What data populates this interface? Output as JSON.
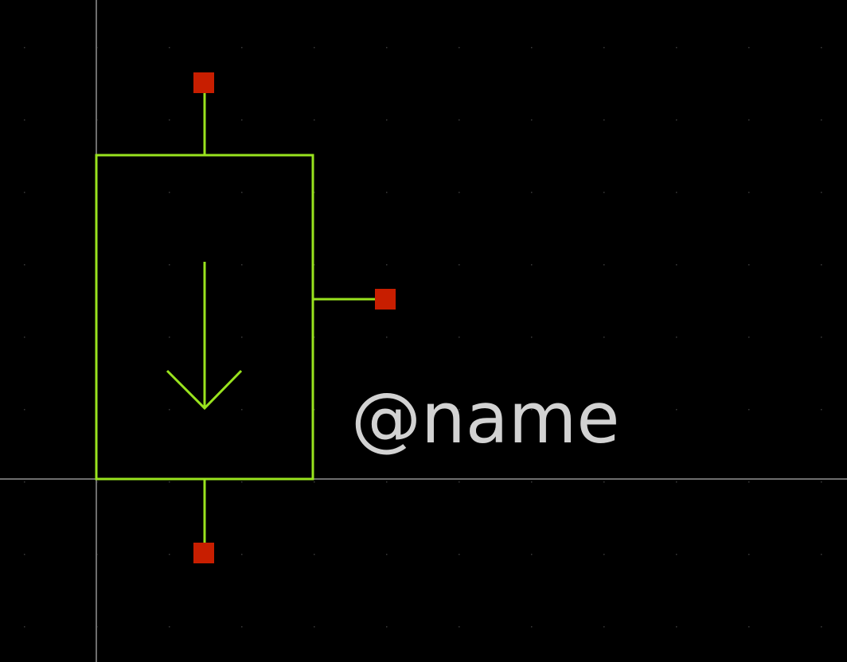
{
  "symbol": {
    "name_label": "@name"
  },
  "colors": {
    "background": "#000000",
    "grid_dot": "#3a3a3a",
    "axis": "#6e6e6e",
    "symbol_line": "#99e31e",
    "pin_marker": "#c81e00",
    "label_text": "#d2d2d2"
  },
  "icons": {
    "arrow": "arrow-down-icon"
  }
}
